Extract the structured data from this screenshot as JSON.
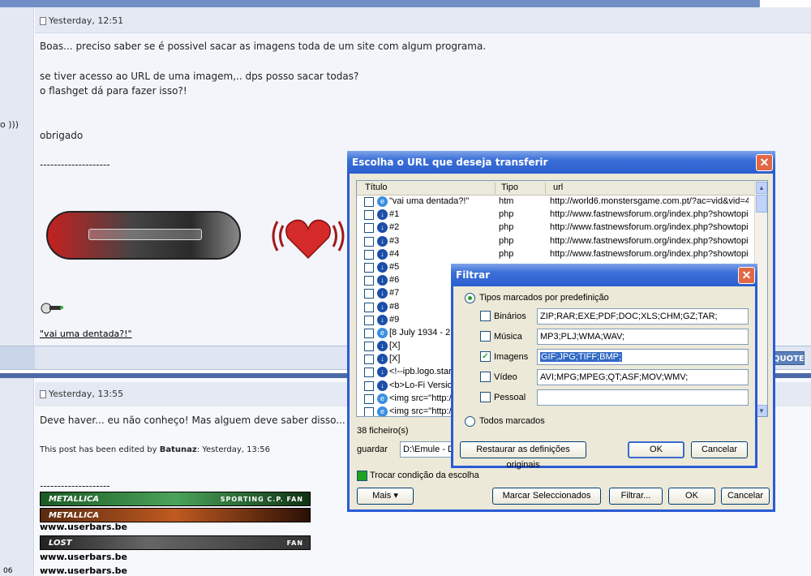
{
  "forum": {
    "post1": {
      "timestamp": "Yesterday, 12:51",
      "lines": [
        "Boas... preciso saber se é possivel sacar as imagens toda de um site com algum programa.",
        "",
        "se tiver acesso ao URL de uma imagem,.. dps posso sacar todas?",
        "o flashget dá para fazer isso?!",
        "",
        "",
        "obrigado",
        "",
        "--------------------"
      ],
      "left_fragment": "o )))",
      "link_text": "\"vai uma dentada?!\""
    },
    "quote_button": "QUOTE",
    "post2": {
      "timestamp": "Yesterday, 13:55",
      "text": "Deve haver... eu não conheço! Mas alguem deve saber disso...",
      "edited_prefix": "This post has been edited by ",
      "edited_user": "Batunaz",
      "edited_suffix": ": Yesterday, 13:56",
      "divider": "--------------------",
      "userbars": [
        {
          "banner": "METALLICA",
          "tag": "SPORTING C.P. FAN",
          "caption": "www.userbars.be"
        },
        {
          "banner": "LOST",
          "tag": "FAN",
          "caption": "www.userbars.be"
        }
      ],
      "last_caption": "www.userbars.be",
      "left_number": "06"
    }
  },
  "url_window": {
    "title": "Escolha o URL que deseja transferir",
    "columns": [
      "Título",
      "Tipo",
      "url"
    ],
    "rows": [
      {
        "title": "\"vai uma dentada?!\"",
        "type": "htm",
        "url": "http://world6.monstersgame.com.pt/?ac=vid&vid=4...",
        "icon": "ie-icon"
      },
      {
        "title": "#1",
        "type": "php",
        "url": "http://www.fastnewsforum.org/index.php?showtopi...",
        "icon": "download-icon"
      },
      {
        "title": "#2",
        "type": "php",
        "url": "http://www.fastnewsforum.org/index.php?showtopi...",
        "icon": "download-icon"
      },
      {
        "title": "#3",
        "type": "php",
        "url": "http://www.fastnewsforum.org/index.php?showtopi...",
        "icon": "download-icon"
      },
      {
        "title": "#4",
        "type": "php",
        "url": "http://www.fastnewsforum.org/index.php?showtopi...",
        "icon": "download-icon"
      },
      {
        "title": "#5",
        "type": "",
        "url": "",
        "icon": "download-icon"
      },
      {
        "title": "#6",
        "type": "",
        "url": "",
        "icon": "download-icon"
      },
      {
        "title": "#7",
        "type": "",
        "url": "",
        "icon": "download-icon"
      },
      {
        "title": "#8",
        "type": "",
        "url": "",
        "icon": "download-icon"
      },
      {
        "title": "#9",
        "type": "",
        "url": "",
        "icon": "download-icon"
      },
      {
        "title": "[8 July 1934 - 2 D",
        "type": "",
        "url": "",
        "icon": "ie-icon"
      },
      {
        "title": "[X]",
        "type": "",
        "url": "",
        "icon": "download-icon"
      },
      {
        "title": "[X]",
        "type": "",
        "url": "",
        "icon": "download-icon"
      },
      {
        "title": "<!--ipb.logo.start-",
        "type": "",
        "url": "",
        "icon": "download-icon"
      },
      {
        "title": "<b>Lo-Fi Version<",
        "type": "",
        "url": "",
        "icon": "download-icon"
      },
      {
        "title": "<img src=\"http://",
        "type": "",
        "url": "",
        "icon": "ie-icon"
      },
      {
        "title": "<img src=\"http://",
        "type": "",
        "url": "",
        "icon": "ie-icon"
      }
    ],
    "file_count": "38 ficheiro(s)",
    "save_label": "guardar",
    "save_path": "D:\\Emule - Do",
    "toggle_label": "Trocar condição da escolha",
    "toggle_checked": true,
    "buttons": {
      "more": "Mais",
      "mark": "Marcar Seleccionados",
      "filter": "Filtrar...",
      "ok": "OK",
      "cancel": "Cancelar"
    }
  },
  "filter_dialog": {
    "title": "Filtrar",
    "radio_predefined": "Tipos marcados por predefinição",
    "radio_all": "Todos marcados",
    "categories": [
      {
        "label": "Binários",
        "checked": false,
        "value": "ZIP;RAR;EXE;PDF;DOC;XLS;CHM;GZ;TAR;"
      },
      {
        "label": "Música",
        "checked": false,
        "value": "MP3;PLJ;WMA;WAV;"
      },
      {
        "label": "Imagens",
        "checked": true,
        "value": "GIF;JPG;TIFF;BMP;"
      },
      {
        "label": "Vídeo",
        "checked": false,
        "value": "AVI;MPG;MPEG;QT;ASF;MOV;WMV;"
      },
      {
        "label": "Pessoal",
        "checked": false,
        "value": ""
      }
    ],
    "buttons": {
      "restore": "Restaurar as definições originais",
      "ok": "OK",
      "cancel": "Cancelar"
    }
  },
  "colors": {
    "titlebar": "#2b5fcf",
    "window_bg": "#ece9d8",
    "forum_header": "#e4e9f3",
    "check_green": "#21a121"
  }
}
